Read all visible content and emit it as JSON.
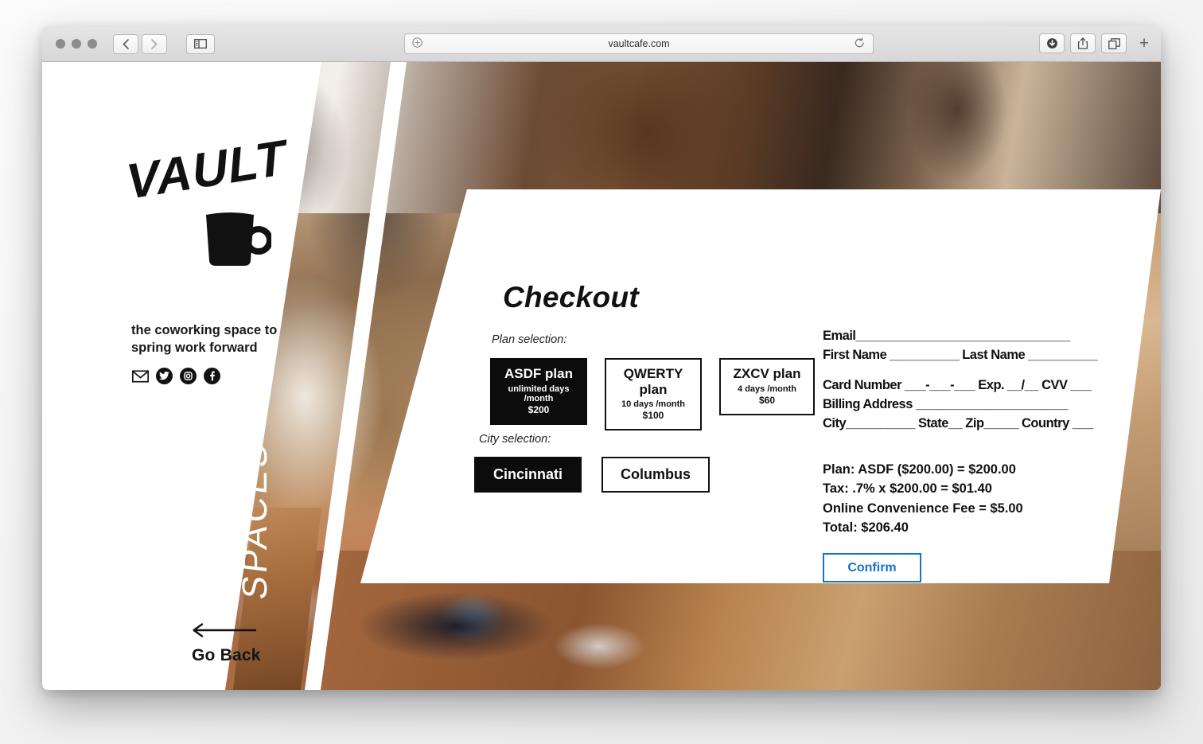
{
  "browser": {
    "url": "vaultcafe.com",
    "traffic_lights": [
      "close",
      "minimize",
      "maximize"
    ],
    "back_icon": "chevron-left-icon",
    "forward_icon": "chevron-right-icon",
    "sidebar_icon": "sidebar-icon",
    "url_left_icon": "add-bookmark-icon",
    "reload_icon": "reload-icon",
    "download_icon": "download-icon",
    "share_icon": "share-icon",
    "tabs_icon": "show-tabs-icon",
    "new_tab_label": "+"
  },
  "brand": {
    "logo_word": "VAULT",
    "logo_icon": "coffee-mug-icon",
    "tagline": "the coworking space to spring work forward",
    "socials": [
      {
        "name": "email-icon",
        "glyph": "✉"
      },
      {
        "name": "twitter-icon",
        "glyph": "ᴠ"
      },
      {
        "name": "instagram-icon",
        "glyph": "▣"
      },
      {
        "name": "facebook-icon",
        "glyph": "f"
      }
    ]
  },
  "nav": {
    "go_back_label": "Go Back",
    "go_back_icon": "arrow-left-icon",
    "vertical_label": "SPACES"
  },
  "checkout": {
    "title": "Checkout",
    "plan_section_label": "Plan selection:",
    "plans": [
      {
        "name": "ASDF plan",
        "days": "unlimited days /month",
        "price": "$200",
        "selected": true
      },
      {
        "name": "QWERTY plan",
        "days": "10 days /month",
        "price": "$100",
        "selected": false
      },
      {
        "name": "ZXCV plan",
        "days": "4 days /month",
        "price": "$60",
        "selected": false
      }
    ],
    "city_section_label": "City selection:",
    "cities": [
      {
        "name": "Cincinnati",
        "selected": true
      },
      {
        "name": "Columbus",
        "selected": false
      }
    ],
    "form": {
      "email": "Email_______________________________",
      "first_last": "First Name __________  Last Name __________",
      "card_number": "Card Number ___-___-___  Exp. __/__ CVV ___",
      "billing_address": "Billing Address ______________________",
      "city_state_zip": "City__________ State__  Zip_____  Country ___"
    },
    "summary": [
      "Plan: ASDF ($200.00) = $200.00",
      "Tax: .7% x $200.00 = $01.40",
      "Online Convenience Fee = $5.00",
      "Total: $206.40"
    ],
    "confirm_label": "Confirm",
    "accent_color": "#1673c4"
  }
}
